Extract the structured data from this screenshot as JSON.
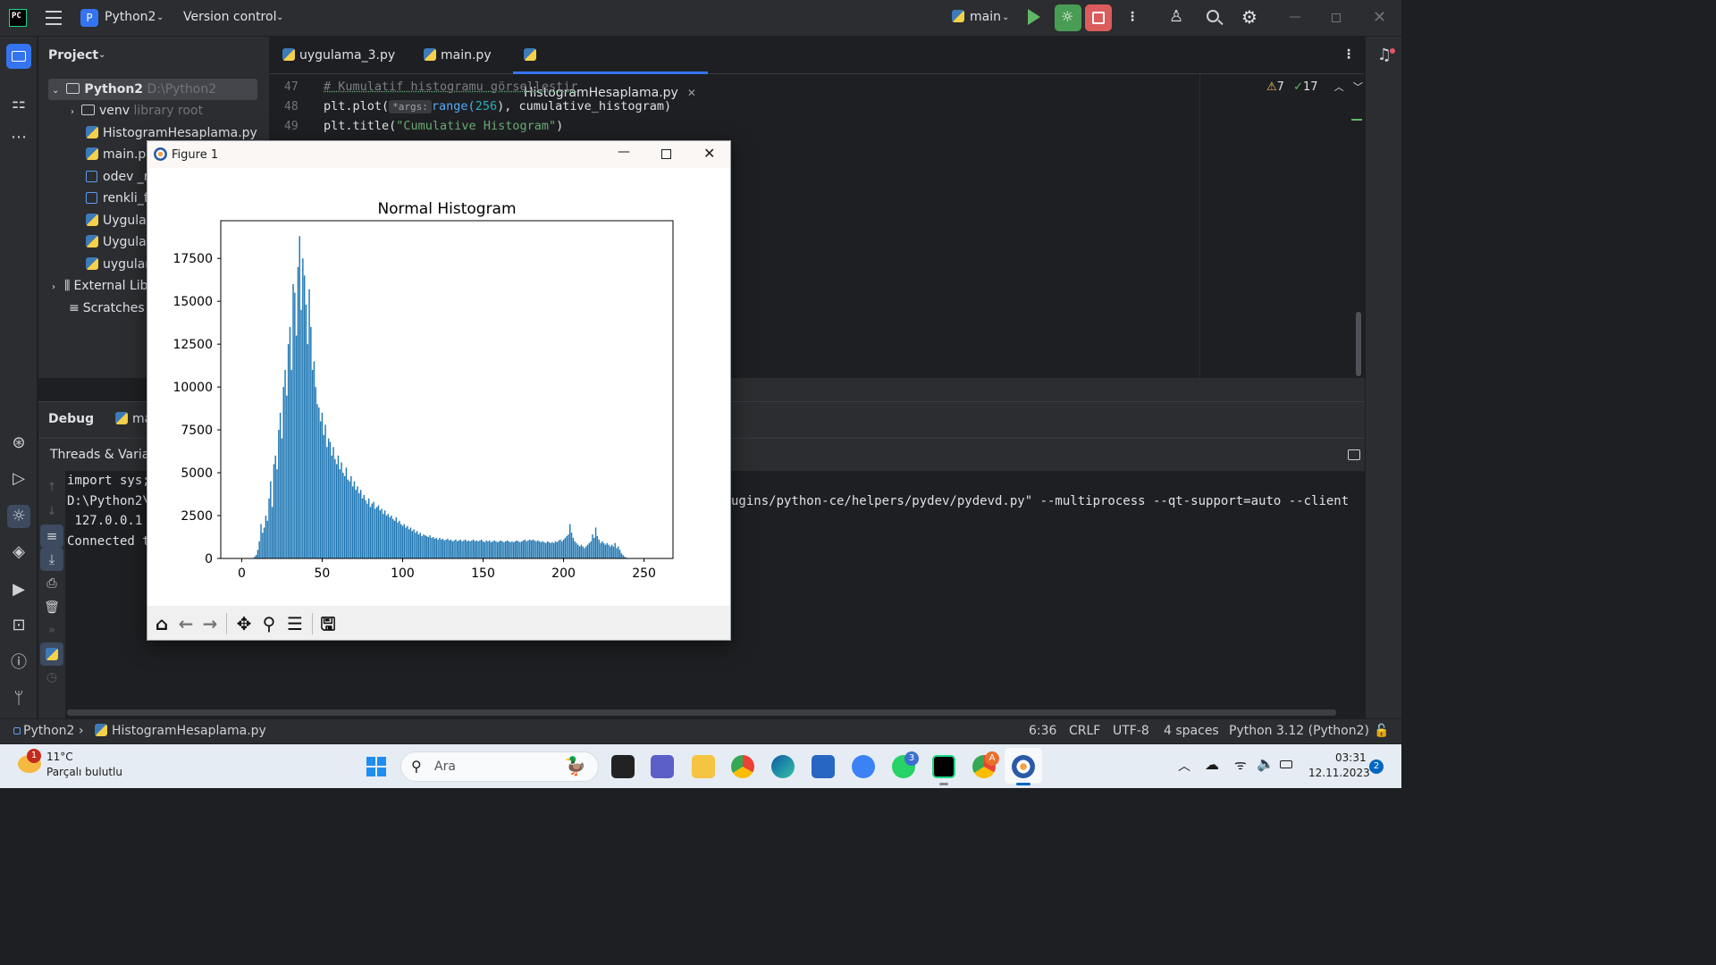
{
  "titlebar": {
    "project_badge": "P",
    "project_name": "Python2",
    "vcs": "Version control",
    "run_config": "main"
  },
  "project_panel": {
    "title": "Project",
    "items": [
      {
        "name": "Python2",
        "hint": "D:\\Python2"
      },
      {
        "name": "venv",
        "hint": "library root"
      },
      {
        "name": "HistogramHesaplama.py"
      },
      {
        "name": "main.py"
      },
      {
        "name": "odev _re"
      },
      {
        "name": "renkli_fo"
      },
      {
        "name": "Uygulan"
      },
      {
        "name": "Uygulan"
      },
      {
        "name": "uygulam"
      },
      {
        "name": "External Lib"
      },
      {
        "name": "Scratches a"
      }
    ]
  },
  "editor": {
    "tabs": [
      {
        "label": "uygulama_3.py"
      },
      {
        "label": "main.py"
      },
      {
        "label": "HistogramHesaplama.py"
      }
    ],
    "lines": [
      {
        "no": "47",
        "comment": "# Kumulatif histogramu görsellestir"
      },
      {
        "no": "48",
        "pre": "plt.plot(",
        "hint": "*args:",
        "fn": "range(",
        "num": "256",
        "post": "), cumulative_histogram)"
      },
      {
        "no": "49",
        "pre": "plt.title(",
        "str": "\"Cumulative Histogram\"",
        "post": ")"
      }
    ],
    "warnings": "7",
    "checks": "17"
  },
  "debug": {
    "title": "Debug",
    "tab": "ma",
    "threads_label": "Threads & Variab",
    "console": {
      "line1": "import sys;",
      "line2": "D:\\Python2\\",
      "line2_right": "ugins/python-ce/helpers/pydev/pydevd.py\" --multiprocess --qt-support=auto --client",
      "line3": " 127.0.0.1",
      "line4": "Connected t"
    }
  },
  "statusbar": {
    "crumb_project": "Python2",
    "crumb_file": "HistogramHesaplama.py",
    "position": "6:36",
    "line_sep": "CRLF",
    "encoding": "UTF-8",
    "indent": "4 spaces",
    "interpreter": "Python 3.12 (Python2)"
  },
  "taskbar": {
    "weather_temp": "11°C",
    "weather_desc": "Parçalı bulutlu",
    "weather_badge": "1",
    "search_placeholder": "Ara",
    "whatsapp_badge": "3",
    "chrome_badge": "A",
    "time": "03:31",
    "date": "12.11.2023",
    "notif_count": "2"
  },
  "figure": {
    "window_title": "Figure 1"
  },
  "chart_data": {
    "type": "bar",
    "title": "Normal Histogram",
    "xlabel": "",
    "ylabel": "",
    "xlim": [
      -13,
      268
    ],
    "ylim": [
      0,
      19700
    ],
    "xticks": [
      "0",
      "50",
      "100",
      "150",
      "200",
      "250"
    ],
    "yticks": [
      "0",
      "2500",
      "5000",
      "7500",
      "10000",
      "12500",
      "15000",
      "17500"
    ],
    "color": "#1f77b4",
    "bins": [
      0,
      0,
      0,
      0,
      0,
      0,
      0,
      0,
      100,
      200,
      500,
      1000,
      2000,
      1500,
      1800,
      2500,
      2200,
      3500,
      4500,
      3000,
      5500,
      6000,
      5200,
      7500,
      8500,
      7000,
      10000,
      11000,
      9500,
      12500,
      13500,
      11000,
      16000,
      15500,
      13000,
      17000,
      18800,
      14500,
      17500,
      16500,
      14800,
      12500,
      15700,
      13500,
      11000,
      11500,
      10000,
      9000,
      8800,
      8000,
      8500,
      7200,
      7800,
      6500,
      7000,
      6800,
      6000,
      6500,
      5800,
      5500,
      6000,
      5200,
      5600,
      5000,
      4800,
      5300,
      4600,
      4500,
      4800,
      4200,
      4500,
      4000,
      4200,
      3800,
      4000,
      3500,
      3700,
      3400,
      3200,
      3500,
      3000,
      3200,
      3300,
      2900,
      3000,
      3100,
      2800,
      2900,
      2600,
      2800,
      2500,
      2600,
      2400,
      2500,
      2300,
      2200,
      2400,
      2100,
      2200,
      2000,
      1900,
      2000,
      1800,
      1900,
      1700,
      1800,
      1600,
      1700,
      1500,
      1600,
      1400,
      1500,
      1300,
      1400,
      1350,
      1300,
      1250,
      1350,
      1200,
      1250,
      1150,
      1200,
      1100,
      1200,
      1100,
      1150,
      1050,
      1100,
      1150,
      1050,
      1100,
      1000,
      1050,
      1100,
      1000,
      1050,
      1100,
      1000,
      1050,
      1100,
      1000,
      1050,
      1000,
      1050,
      1100,
      1000,
      1050,
      1000,
      1050,
      1100,
      1000,
      950,
      1050,
      1000,
      1050,
      950,
      1000,
      1050,
      1000,
      950,
      1000,
      1050,
      1000,
      950,
      1000,
      1050,
      1000,
      950,
      1000,
      950,
      1000,
      1050,
      1000,
      950,
      1000,
      1050,
      1100,
      1000,
      1050,
      1100,
      1050,
      1100,
      1050,
      1000,
      1050,
      1000,
      950,
      1000,
      950,
      900,
      1000,
      950,
      900,
      950,
      900,
      1000,
      950,
      1050,
      1100,
      1000,
      1100,
      1200,
      1300,
      1400,
      2000,
      1500,
      1200,
      1000,
      900,
      800,
      700,
      800,
      700,
      600,
      700,
      800,
      900,
      1000,
      1400,
      1200,
      1800,
      1300,
      1100,
      900,
      1000,
      900,
      800,
      900,
      800,
      700,
      800,
      700,
      900,
      600,
      700,
      500,
      300,
      200,
      100,
      50,
      0,
      0,
      0,
      0,
      0,
      0,
      0,
      0,
      0
    ]
  }
}
